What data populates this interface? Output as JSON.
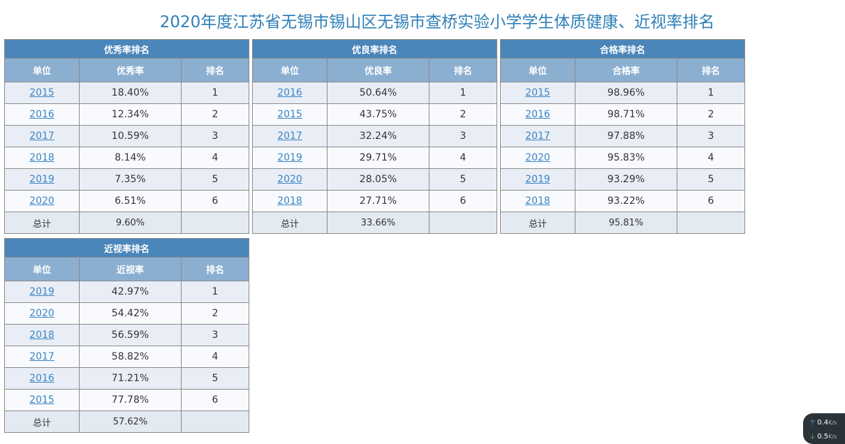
{
  "page": {
    "title": "2020年度江苏省无锡市锡山区无锡市查桥实验小学学生体质健康、近视率排名"
  },
  "tables": [
    {
      "title": "优秀率排名",
      "headers": [
        "单位",
        "优秀率",
        "排名"
      ],
      "rows": [
        {
          "year": "2015",
          "value": "18.40%",
          "rank": "1"
        },
        {
          "year": "2016",
          "value": "12.34%",
          "rank": "2"
        },
        {
          "year": "2017",
          "value": "10.59%",
          "rank": "3"
        },
        {
          "year": "2018",
          "value": "8.14%",
          "rank": "4"
        },
        {
          "year": "2019",
          "value": "7.35%",
          "rank": "5"
        },
        {
          "year": "2020",
          "value": "6.51%",
          "rank": "6"
        }
      ],
      "total": {
        "label": "总计",
        "value": "9.60%",
        "rank": ""
      }
    },
    {
      "title": "优良率排名",
      "headers": [
        "单位",
        "优良率",
        "排名"
      ],
      "rows": [
        {
          "year": "2016",
          "value": "50.64%",
          "rank": "1"
        },
        {
          "year": "2015",
          "value": "43.75%",
          "rank": "2"
        },
        {
          "year": "2017",
          "value": "32.24%",
          "rank": "3"
        },
        {
          "year": "2019",
          "value": "29.71%",
          "rank": "4"
        },
        {
          "year": "2020",
          "value": "28.05%",
          "rank": "5"
        },
        {
          "year": "2018",
          "value": "27.71%",
          "rank": "6"
        }
      ],
      "total": {
        "label": "总计",
        "value": "33.66%",
        "rank": ""
      }
    },
    {
      "title": "合格率排名",
      "headers": [
        "单位",
        "合格率",
        "排名"
      ],
      "rows": [
        {
          "year": "2015",
          "value": "98.96%",
          "rank": "1"
        },
        {
          "year": "2016",
          "value": "98.71%",
          "rank": "2"
        },
        {
          "year": "2017",
          "value": "97.88%",
          "rank": "3"
        },
        {
          "year": "2020",
          "value": "95.83%",
          "rank": "4"
        },
        {
          "year": "2019",
          "value": "93.29%",
          "rank": "5"
        },
        {
          "year": "2018",
          "value": "93.22%",
          "rank": "6"
        }
      ],
      "total": {
        "label": "总计",
        "value": "95.81%",
        "rank": ""
      }
    },
    {
      "title": "近视率排名",
      "headers": [
        "单位",
        "近视率",
        "排名"
      ],
      "rows": [
        {
          "year": "2019",
          "value": "42.97%",
          "rank": "1"
        },
        {
          "year": "2020",
          "value": "54.42%",
          "rank": "2"
        },
        {
          "year": "2018",
          "value": "56.59%",
          "rank": "3"
        },
        {
          "year": "2017",
          "value": "58.82%",
          "rank": "4"
        },
        {
          "year": "2016",
          "value": "71.21%",
          "rank": "5"
        },
        {
          "year": "2015",
          "value": "77.78%",
          "rank": "6"
        }
      ],
      "total": {
        "label": "总计",
        "value": "57.62%",
        "rank": ""
      }
    }
  ],
  "net_speed": {
    "upload": "0.4",
    "download": "0.5",
    "unit": "K/s",
    "upload_icon": "arrow-up-icon",
    "download_icon": "arrow-down-icon"
  },
  "colors": {
    "title_text": "#2e7fb8",
    "table_title_bg": "#4a86ba",
    "header_bg": "#8bafd1",
    "link": "#3a84c3"
  }
}
